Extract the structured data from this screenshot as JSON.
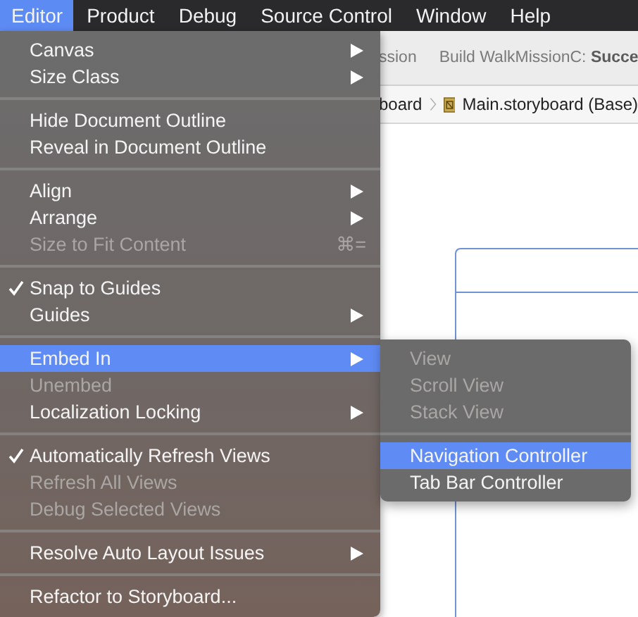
{
  "menu_bar": {
    "items": [
      {
        "label": "Editor",
        "selected": true
      },
      {
        "label": "Product",
        "selected": false
      },
      {
        "label": "Debug",
        "selected": false
      },
      {
        "label": "Source Control",
        "selected": false
      },
      {
        "label": "Window",
        "selected": false
      },
      {
        "label": "Help",
        "selected": false
      }
    ]
  },
  "toolbar": {
    "activity": "ssion",
    "status": "Build WalkMissionC: **Succe**"
  },
  "jump_bar": {
    "items": [
      "board",
      "Main.storyboard (Base)"
    ]
  },
  "editor_menu": {
    "groups": [
      [
        {
          "label": "Canvas",
          "has_submenu": true,
          "disabled": false,
          "checked": false,
          "selected": false
        },
        {
          "label": "Size Class",
          "has_submenu": true,
          "disabled": false,
          "checked": false,
          "selected": false
        }
      ],
      [
        {
          "label": "Hide Document Outline",
          "has_submenu": false,
          "disabled": false,
          "checked": false,
          "selected": false
        },
        {
          "label": "Reveal in Document Outline",
          "has_submenu": false,
          "disabled": false,
          "checked": false,
          "selected": false
        }
      ],
      [
        {
          "label": "Align",
          "has_submenu": true,
          "disabled": false,
          "checked": false,
          "selected": false
        },
        {
          "label": "Arrange",
          "has_submenu": true,
          "disabled": false,
          "checked": false,
          "selected": false
        },
        {
          "label": "Size to Fit Content",
          "has_submenu": false,
          "disabled": true,
          "checked": false,
          "selected": false,
          "shortcut": "⌘="
        }
      ],
      [
        {
          "label": "Snap to Guides",
          "has_submenu": false,
          "disabled": false,
          "checked": true,
          "selected": false
        },
        {
          "label": "Guides",
          "has_submenu": true,
          "disabled": false,
          "checked": false,
          "selected": false
        }
      ],
      [
        {
          "label": "Embed In",
          "has_submenu": true,
          "disabled": false,
          "checked": false,
          "selected": true
        },
        {
          "label": "Unembed",
          "has_submenu": false,
          "disabled": true,
          "checked": false,
          "selected": false
        },
        {
          "label": "Localization Locking",
          "has_submenu": true,
          "disabled": false,
          "checked": false,
          "selected": false
        }
      ],
      [
        {
          "label": "Automatically Refresh Views",
          "has_submenu": false,
          "disabled": false,
          "checked": true,
          "selected": false
        },
        {
          "label": "Refresh All Views",
          "has_submenu": false,
          "disabled": true,
          "checked": false,
          "selected": false
        },
        {
          "label": "Debug Selected Views",
          "has_submenu": false,
          "disabled": true,
          "checked": false,
          "selected": false
        }
      ],
      [
        {
          "label": "Resolve Auto Layout Issues",
          "has_submenu": true,
          "disabled": false,
          "checked": false,
          "selected": false
        }
      ],
      [
        {
          "label": "Refactor to Storyboard...",
          "has_submenu": false,
          "disabled": false,
          "checked": false,
          "selected": false
        }
      ]
    ]
  },
  "embed_submenu": {
    "groups": [
      [
        {
          "label": "View",
          "disabled": true,
          "selected": false
        },
        {
          "label": "Scroll View",
          "disabled": true,
          "selected": false
        },
        {
          "label": "Stack View",
          "disabled": true,
          "selected": false
        }
      ],
      [
        {
          "label": "Navigation Controller",
          "disabled": false,
          "selected": true
        },
        {
          "label": "Tab Bar Controller",
          "disabled": false,
          "selected": false
        }
      ]
    ]
  }
}
